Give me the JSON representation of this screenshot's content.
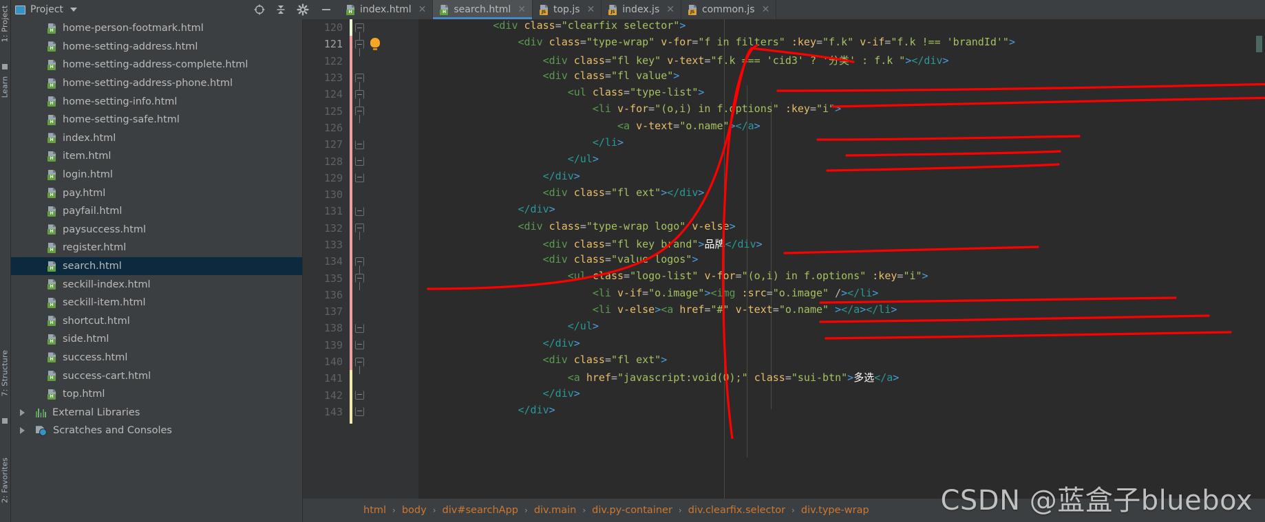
{
  "window": {
    "panel_title": "Project",
    "vertical_tabs": [
      "1: Project",
      "Learn",
      "7: Structure",
      "2: Favorites"
    ],
    "toolbar_icons": [
      "locate-target-icon",
      "collapse-all-icon",
      "settings-gear-icon",
      "minimize-icon"
    ]
  },
  "tree": {
    "items": [
      {
        "label": "home-person-footmark.html",
        "type": "html"
      },
      {
        "label": "home-setting-address.html",
        "type": "html"
      },
      {
        "label": "home-setting-address-complete.html",
        "type": "html"
      },
      {
        "label": "home-setting-address-phone.html",
        "type": "html"
      },
      {
        "label": "home-setting-info.html",
        "type": "html"
      },
      {
        "label": "home-setting-safe.html",
        "type": "html"
      },
      {
        "label": "index.html",
        "type": "html"
      },
      {
        "label": "item.html",
        "type": "html"
      },
      {
        "label": "login.html",
        "type": "html"
      },
      {
        "label": "pay.html",
        "type": "html"
      },
      {
        "label": "payfail.html",
        "type": "html"
      },
      {
        "label": "paysuccess.html",
        "type": "html"
      },
      {
        "label": "register.html",
        "type": "html"
      },
      {
        "label": "search.html",
        "type": "html",
        "selected": true
      },
      {
        "label": "seckill-index.html",
        "type": "html"
      },
      {
        "label": "seckill-item.html",
        "type": "html"
      },
      {
        "label": "shortcut.html",
        "type": "html"
      },
      {
        "label": "side.html",
        "type": "html"
      },
      {
        "label": "success.html",
        "type": "html"
      },
      {
        "label": "success-cart.html",
        "type": "html"
      },
      {
        "label": "top.html",
        "type": "html"
      }
    ],
    "nodes": [
      {
        "label": "External Libraries",
        "icon": "library-icon"
      },
      {
        "label": "Scratches and Consoles",
        "icon": "scratch-icon"
      }
    ]
  },
  "tabs": [
    {
      "label": "index.html",
      "type": "html",
      "active": false
    },
    {
      "label": "search.html",
      "type": "html",
      "active": true
    },
    {
      "label": "top.js",
      "type": "js",
      "active": false
    },
    {
      "label": "index.js",
      "type": "js",
      "active": false
    },
    {
      "label": "common.js",
      "type": "js",
      "active": false
    }
  ],
  "editor": {
    "first_line": 120,
    "lines": [
      {
        "n": 120,
        "text": "            <div class=\"clearfix selector\">"
      },
      {
        "n": 121,
        "text": "                <div class=\"type-wrap\" v-for=\"f in filters\" :key=\"f.k\" v-if=\"f.k !== 'brandId'\">"
      },
      {
        "n": 122,
        "text": "                    <div class=\"fl key\" v-text=\"f.k === 'cid3' ? '分类' : f.k \"></div>"
      },
      {
        "n": 123,
        "text": "                    <div class=\"fl value\">"
      },
      {
        "n": 124,
        "text": "                        <ul class=\"type-list\">"
      },
      {
        "n": 125,
        "text": "                            <li v-for=\"(o,i) in f.options\" :key=\"i\">"
      },
      {
        "n": 126,
        "text": "                                <a v-text=\"o.name\"></a>"
      },
      {
        "n": 127,
        "text": "                            </li>"
      },
      {
        "n": 128,
        "text": "                        </ul>"
      },
      {
        "n": 129,
        "text": "                    </div>"
      },
      {
        "n": 130,
        "text": "                    <div class=\"fl ext\"></div>"
      },
      {
        "n": 131,
        "text": "                </div>"
      },
      {
        "n": 132,
        "text": "                <div class=\"type-wrap logo\" v-else>"
      },
      {
        "n": 133,
        "text": "                    <div class=\"fl key brand\">品牌</div>"
      },
      {
        "n": 134,
        "text": "                    <div class=\"value logos\">"
      },
      {
        "n": 135,
        "text": "                        <ul class=\"logo-list\" v-for=\"(o,i) in f.options\" :key=\"i\">"
      },
      {
        "n": 136,
        "text": "                            <li v-if=\"o.image\"><img :src=\"o.image\" /></li>"
      },
      {
        "n": 137,
        "text": "                            <li v-else><a href=\"#\" v-text=\"o.name\" ></a></li>"
      },
      {
        "n": 138,
        "text": "                        </ul>"
      },
      {
        "n": 139,
        "text": "                    </div>"
      },
      {
        "n": 140,
        "text": "                    <div class=\"fl ext\">"
      },
      {
        "n": 141,
        "text": "                        <a href=\"javascript:void(0);\" class=\"sui-btn\">多选</a>"
      },
      {
        "n": 142,
        "text": "                    </div>"
      },
      {
        "n": 143,
        "text": "                </div>"
      }
    ]
  },
  "breadcrumb": [
    "html",
    "body",
    "div#searchApp",
    "div.main",
    "div.py-container",
    "div.clearfix.selector",
    "div.type-wrap"
  ],
  "browsers": [
    {
      "name": "chrome-icon",
      "color": "#4285F4"
    },
    {
      "name": "firefox-icon",
      "color": "#E66000"
    },
    {
      "name": "safari-icon",
      "color": "#1B88CA"
    },
    {
      "name": "opera-icon",
      "color": "#CC0F16"
    },
    {
      "name": "internet-explorer-icon",
      "color": "#1EBBEE"
    },
    {
      "name": "edge-icon",
      "color": "#0078D7"
    }
  ],
  "watermark": "CSDN @蓝盒子bluebox",
  "colors": {
    "accent": "#4a88c7",
    "selection": "#0d293e",
    "editor_bg": "#2b2b2b",
    "panel_bg": "#3c3f41",
    "annotation": "#ff0000",
    "string": "#a5c261",
    "tag": "#e8bf6a",
    "breadcrumb": "#cc7832"
  }
}
